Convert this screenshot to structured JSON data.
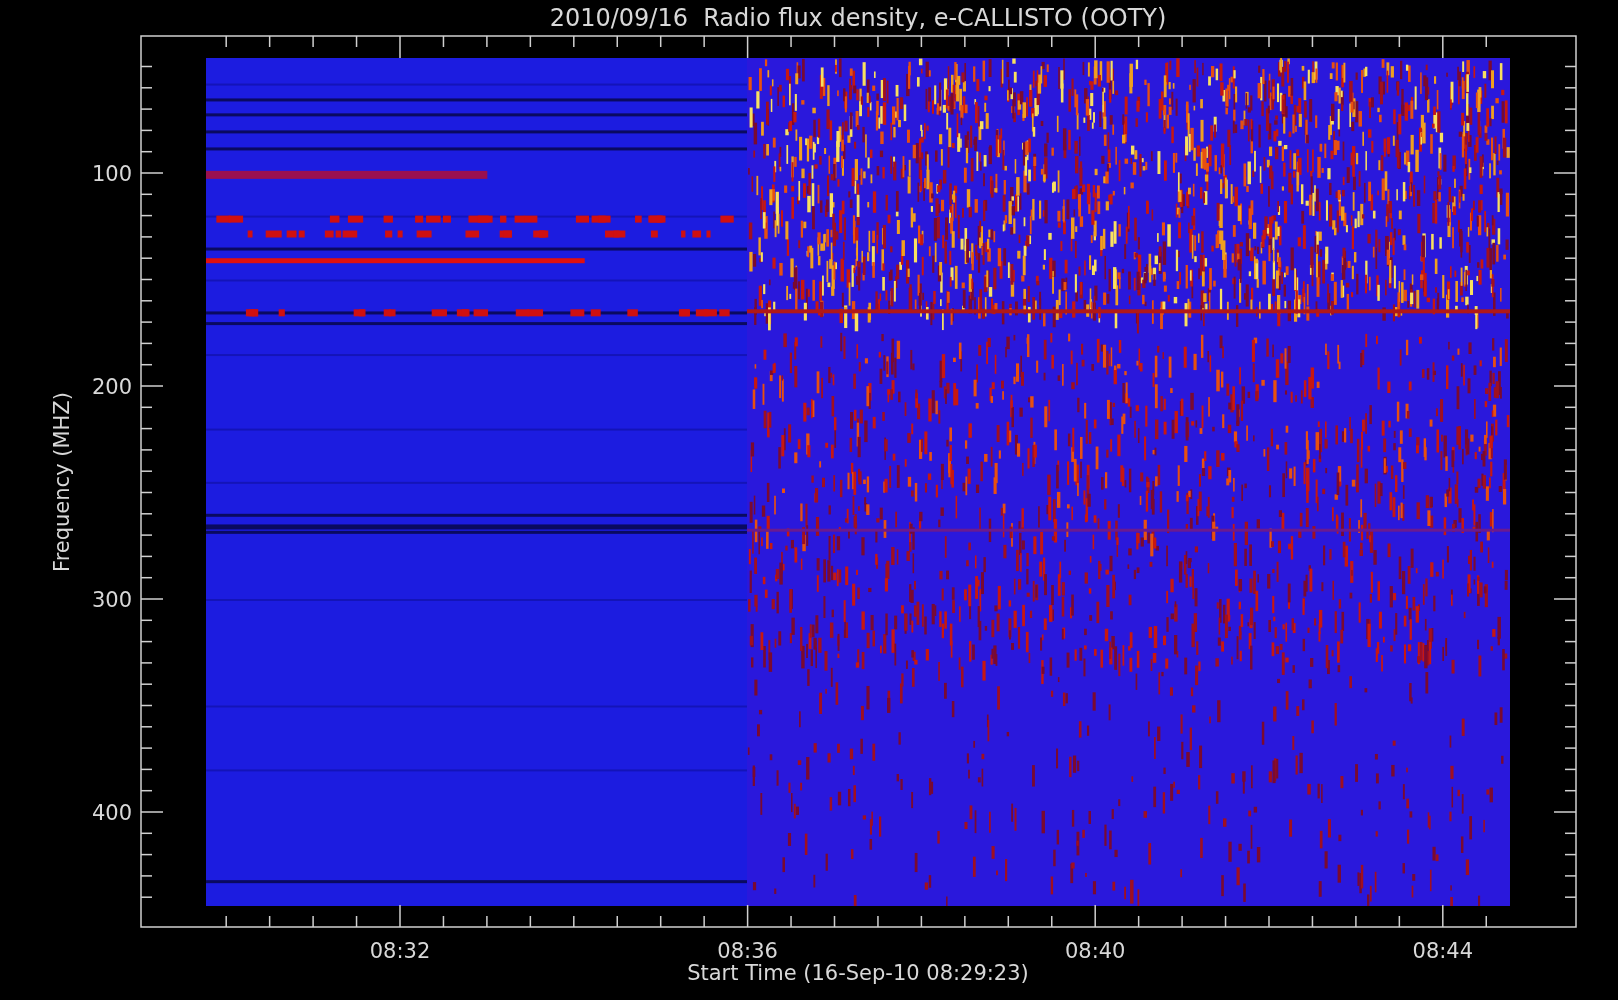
{
  "plot": {
    "title": "2010/09/16  Radio flux density, e-CALLISTO (OOTY)",
    "ylabel": "Frequency (MHZ)",
    "xlabel": "Start Time (16-Sep-10 08:29:23)",
    "y_tick_labels": [
      "100",
      "200",
      "300",
      "400"
    ],
    "x_tick_labels": [
      "08:32",
      "08:36",
      "08:40",
      "08:44"
    ]
  }
}
